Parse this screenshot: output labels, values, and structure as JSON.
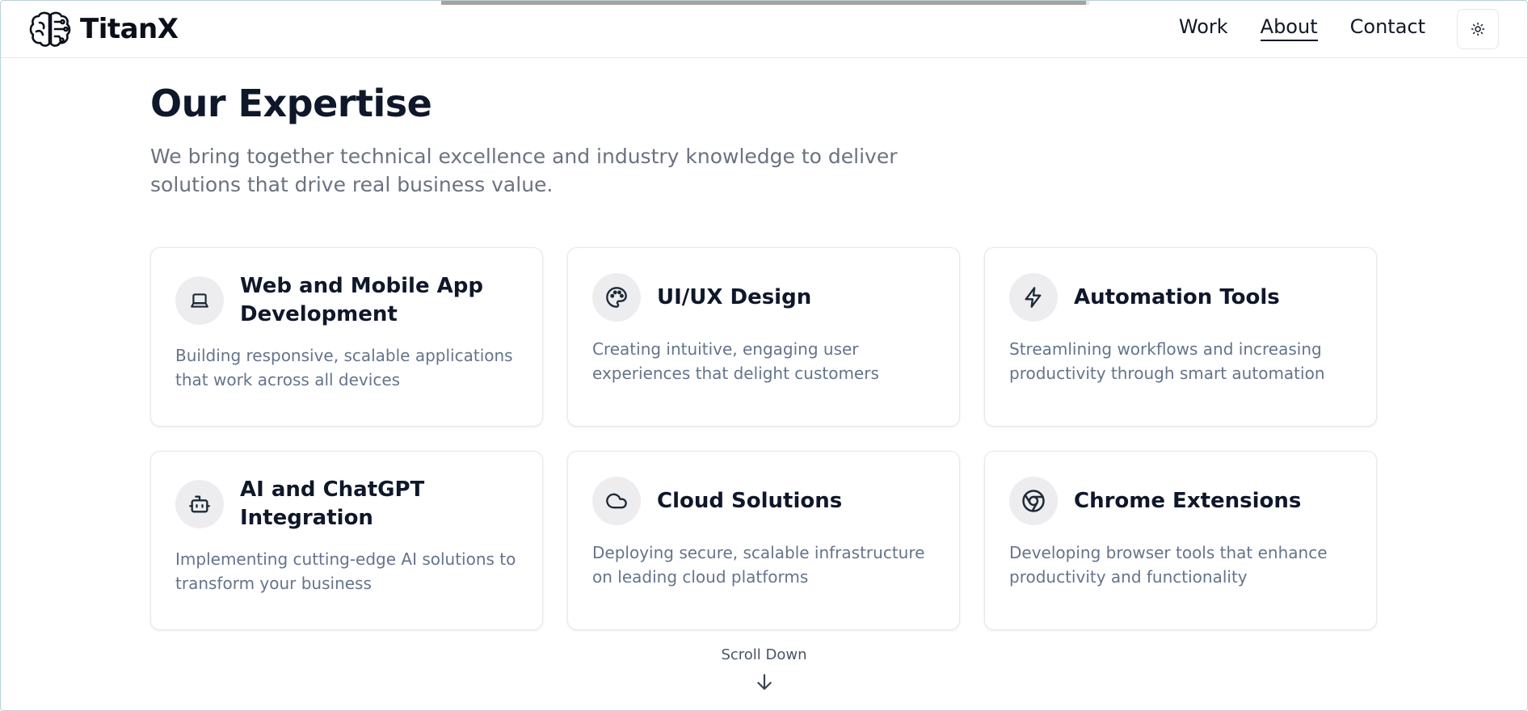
{
  "header": {
    "brand_name": "TitanX",
    "nav": [
      {
        "label": "Work",
        "active": false
      },
      {
        "label": "About",
        "active": true
      },
      {
        "label": "Contact",
        "active": false
      }
    ],
    "theme_icon": "sun-icon"
  },
  "reading_progress": 0.995,
  "main": {
    "title": "Our Expertise",
    "subtitle": "We bring together technical excellence and industry knowledge to deliver solutions that drive real business value.",
    "cards": [
      {
        "icon": "laptop-icon",
        "title": "Web and Mobile App Development",
        "description": "Building responsive, scalable applications that work across all devices"
      },
      {
        "icon": "palette-icon",
        "title": "UI/UX Design",
        "description": "Creating intuitive, engaging user experiences that delight customers"
      },
      {
        "icon": "lightning-icon",
        "title": "Automation Tools",
        "description": "Streamlining workflows and increasing productivity through smart automation"
      },
      {
        "icon": "robot-icon",
        "title": "AI and ChatGPT Integration",
        "description": "Implementing cutting-edge AI solutions to transform your business"
      },
      {
        "icon": "cloud-icon",
        "title": "Cloud Solutions",
        "description": "Deploying secure, scalable infrastructure on leading cloud platforms"
      },
      {
        "icon": "chrome-icon",
        "title": "Chrome Extensions",
        "description": "Developing browser tools that enhance productivity and functionality"
      }
    ]
  },
  "scroll": {
    "label": "Scroll Down",
    "icon": "arrow-down-icon"
  }
}
